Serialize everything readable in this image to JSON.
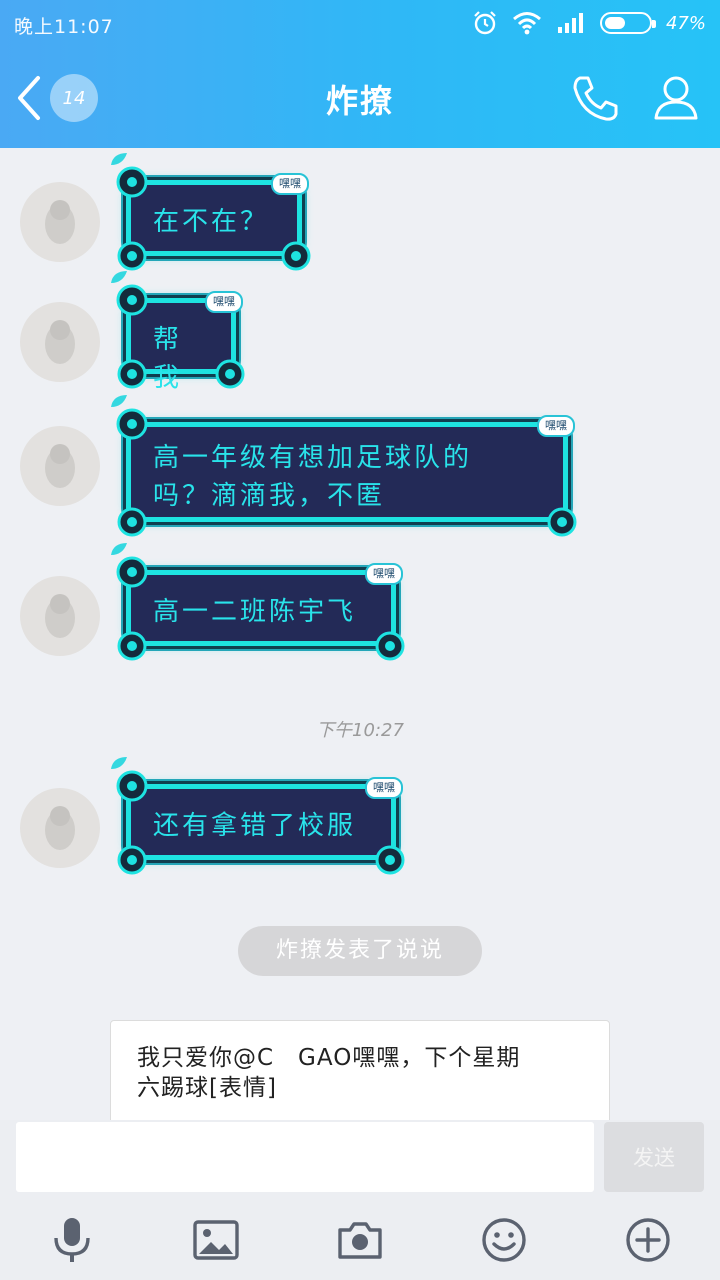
{
  "status": {
    "time": "晚上11:07",
    "battery": "47%",
    "battery_level": 0.47
  },
  "header": {
    "unread_count": "14",
    "title": "炸撩"
  },
  "messages": [
    {
      "tag": "嘿嘿",
      "lines": [
        "在不在？"
      ]
    },
    {
      "tag": "嘿嘿",
      "lines": [
        "帮我"
      ]
    },
    {
      "tag": "嘿嘿",
      "lines": [
        "高一年级有想加足球队的",
        "吗？滴滴我，不匿"
      ]
    },
    {
      "tag": "嘿嘿",
      "lines": [
        "高一二班陈宇飞"
      ]
    },
    {
      "tag": "嘿嘿",
      "lines": [
        "还有拿错了校服"
      ]
    }
  ],
  "timestamp": "下午10:27",
  "system_notice": "炸撩发表了说说",
  "post": {
    "text_line1": "我只爱你@C　GAO嘿嘿，下个星期",
    "text_line2": "六踢球[表情]"
  },
  "input": {
    "value": "",
    "send_label": "发送"
  },
  "icons": {
    "back": "chevron-left-icon",
    "call": "phone-icon",
    "profile": "person-icon",
    "voice": "microphone-icon",
    "image": "image-icon",
    "camera": "camera-icon",
    "emoji": "smiley-icon",
    "more": "plus-circle-icon"
  },
  "colors": {
    "header_start": "#4aa9f4",
    "header_end": "#26c3f7",
    "bubble_bg": "#232a57",
    "bubble_text": "#29e3ea"
  }
}
